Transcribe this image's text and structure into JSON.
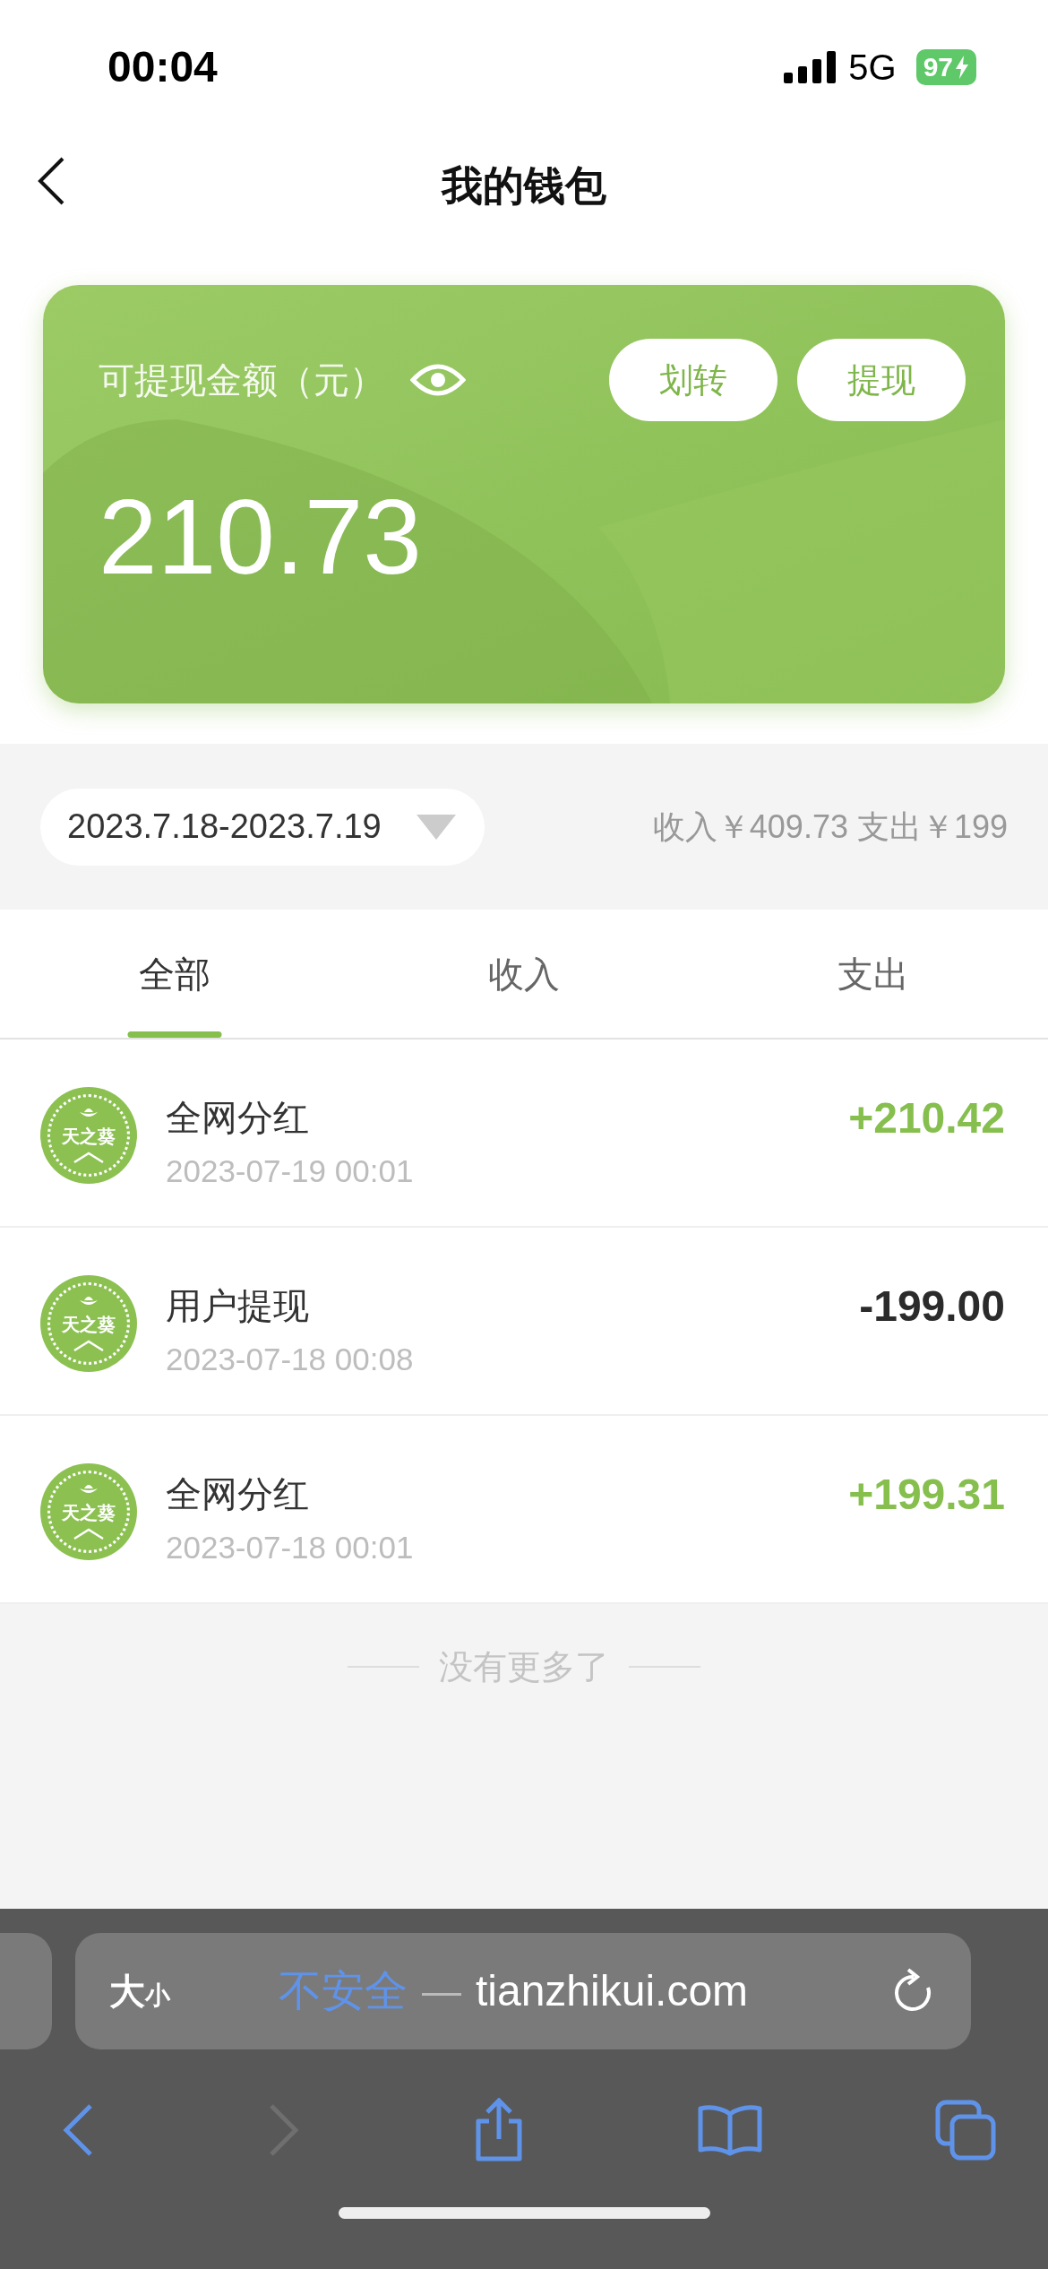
{
  "status_bar": {
    "time": "00:04",
    "network": "5G",
    "battery": "97",
    "charging": true
  },
  "header": {
    "title": "我的钱包"
  },
  "wallet_card": {
    "label": "可提现金额（元）",
    "balance": "210.73",
    "buttons": [
      "划转",
      "提现"
    ]
  },
  "filter": {
    "date_range": "2023.7.18-2023.7.19",
    "summary": "收入￥409.73 支出￥199"
  },
  "tabs": [
    {
      "label": "全部",
      "selected": true
    },
    {
      "label": "收入",
      "selected": false
    },
    {
      "label": "支出",
      "selected": false
    }
  ],
  "transactions": [
    {
      "logo": "天之葵",
      "title": "全网分红",
      "time": "2023-07-19 00:01",
      "amount": "+210.42",
      "kind": "income"
    },
    {
      "logo": "天之葵",
      "title": "用户提现",
      "time": "2023-07-18 00:08",
      "amount": "-199.00",
      "kind": "expense"
    },
    {
      "logo": "天之葵",
      "title": "全网分红",
      "time": "2023-07-18 00:01",
      "amount": "+199.31",
      "kind": "income"
    }
  ],
  "list_end": "没有更多了",
  "browser": {
    "text_size": {
      "large": "大",
      "small": "小"
    },
    "security": "不安全",
    "separator": "—",
    "domain": "tianzhikui.com",
    "back_enabled": true,
    "forward_enabled": false
  }
}
